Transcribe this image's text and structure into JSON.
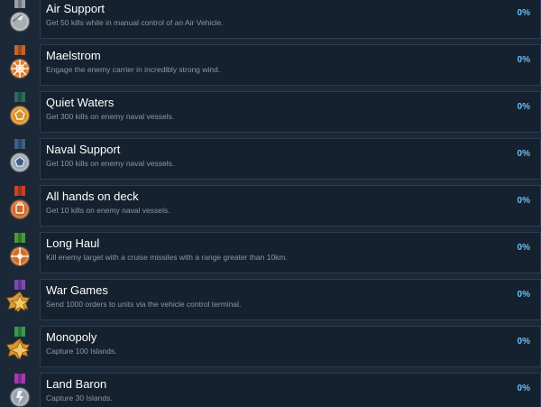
{
  "achievements": [
    {
      "name": "Air Support",
      "description": "Get 50 kills while in manual control of an Air Vehicle.",
      "percent": "0%",
      "icon": "air-support-medal-icon",
      "ribbon": "#9aa0a6",
      "medal": "#a9aeb3"
    },
    {
      "name": "Maelstrom",
      "description": "Engage the enemy carrier in incredibly strong wind.",
      "percent": "0%",
      "icon": "ships-wheel-medal-icon",
      "ribbon": "#c8622a",
      "medal": "#d9772e"
    },
    {
      "name": "Quiet Waters",
      "description": "Get 300 kills on enemy naval vessels.",
      "percent": "0%",
      "icon": "quiet-waters-medal-icon",
      "ribbon": "#2f6a5a",
      "medal": "#d8912f"
    },
    {
      "name": "Naval Support",
      "description": "Get 100 kills on enemy naval vessels.",
      "percent": "0%",
      "icon": "naval-support-medal-icon",
      "ribbon": "#3f5f86",
      "medal": "#9ba7b4"
    },
    {
      "name": "All hands on deck",
      "description": "Get 10 kills on enemy naval vessels.",
      "percent": "0%",
      "icon": "all-hands-medal-icon",
      "ribbon": "#c8422a",
      "medal": "#c9682c"
    },
    {
      "name": "Long Haul",
      "description": "Kill enemy target with a cruise missiles with a range greater than 10km.",
      "percent": "0%",
      "icon": "long-haul-medal-icon",
      "ribbon": "#4a9a3a",
      "medal": "#c8702e"
    },
    {
      "name": "War Games",
      "description": "Send 1000 orders to units via the vehicle control terminal.",
      "percent": "0%",
      "icon": "war-games-star-medal-icon",
      "ribbon": "#7e4ab0",
      "medal": "#d99a3a"
    },
    {
      "name": "Monopoly",
      "description": "Capture 100 Islands.",
      "percent": "0%",
      "icon": "monopoly-star-medal-icon",
      "ribbon": "#3a9a4a",
      "medal": "#d9952e"
    },
    {
      "name": "Land Baron",
      "description": "Capture 30 Islands.",
      "percent": "0%",
      "icon": "land-baron-medal-icon",
      "ribbon": "#a43ab0",
      "medal": "#9aa3ad"
    }
  ]
}
